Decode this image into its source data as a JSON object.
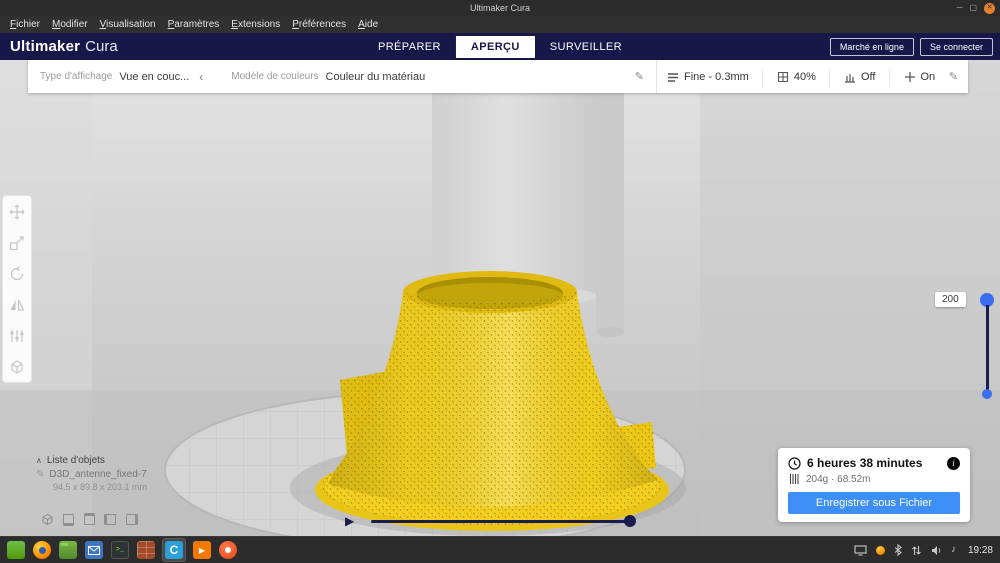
{
  "window": {
    "title": "Ultimaker Cura"
  },
  "menubar": {
    "items": [
      {
        "initial": "F",
        "rest": "ichier"
      },
      {
        "initial": "M",
        "rest": "odifier"
      },
      {
        "initial": "V",
        "rest": "isualisation"
      },
      {
        "initial": "P",
        "rest": "aramètres"
      },
      {
        "initial": "E",
        "rest": "xtensions"
      },
      {
        "initial": "P",
        "rest": "références"
      },
      {
        "initial": "A",
        "rest": "ide"
      }
    ]
  },
  "header": {
    "brand_bold": "Ultimaker",
    "brand_light": "Cura",
    "tab_prepare": "PRÉPARER",
    "tab_preview": "APERÇU",
    "tab_monitor": "SURVEILLER",
    "marketplace": "Marché en ligne",
    "sign_in": "Se connecter"
  },
  "view_options": {
    "display_type_label": "Type d'affichage",
    "display_type_value": "Vue en couc...",
    "color_scheme_label": "Modèle de couleurs",
    "color_scheme_value": "Couleur du matériau"
  },
  "print_settings": {
    "profile": "Fine - 0.3mm",
    "infill": "40%",
    "support": "Off",
    "adhesion": "On"
  },
  "layer_slider": {
    "current_layer": "200"
  },
  "object_list": {
    "title": "Liste d'objets",
    "object_name": "D3D_antenne_fixed-7",
    "object_size": "94.5 x 89.8 x 203.1 mm"
  },
  "print_summary": {
    "time_estimate": "6 heures 38 minutes",
    "material_estimate": "204g · 68.52m",
    "save_button": "Enregistrer sous Fichier"
  },
  "taskbar": {
    "clock": "19:28"
  },
  "colors": {
    "header_bg": "#17174a",
    "accent_blue": "#3a6df0",
    "save_button_blue": "#3d8ef5",
    "model_yellow": "#f6d321"
  },
  "glyphs": {
    "minimize": "─",
    "maximize": "▢",
    "close": "✕",
    "pencil": "✎",
    "chevron": "‹",
    "play": "▶",
    "caret": "∧",
    "info": "i",
    "cura_c": "C",
    "media_play": "▶",
    "music_note": "♪",
    "terminal_prompt": ">_"
  }
}
